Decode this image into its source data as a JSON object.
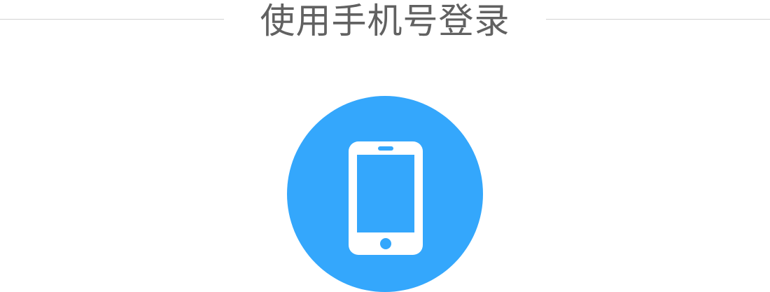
{
  "header": {
    "title": "使用手机号登录"
  },
  "login_option": {
    "icon": "mobile-phone-icon",
    "accent_color": "#34a7fc",
    "divider_color": "#d3d3d3",
    "title_color": "#616161"
  }
}
